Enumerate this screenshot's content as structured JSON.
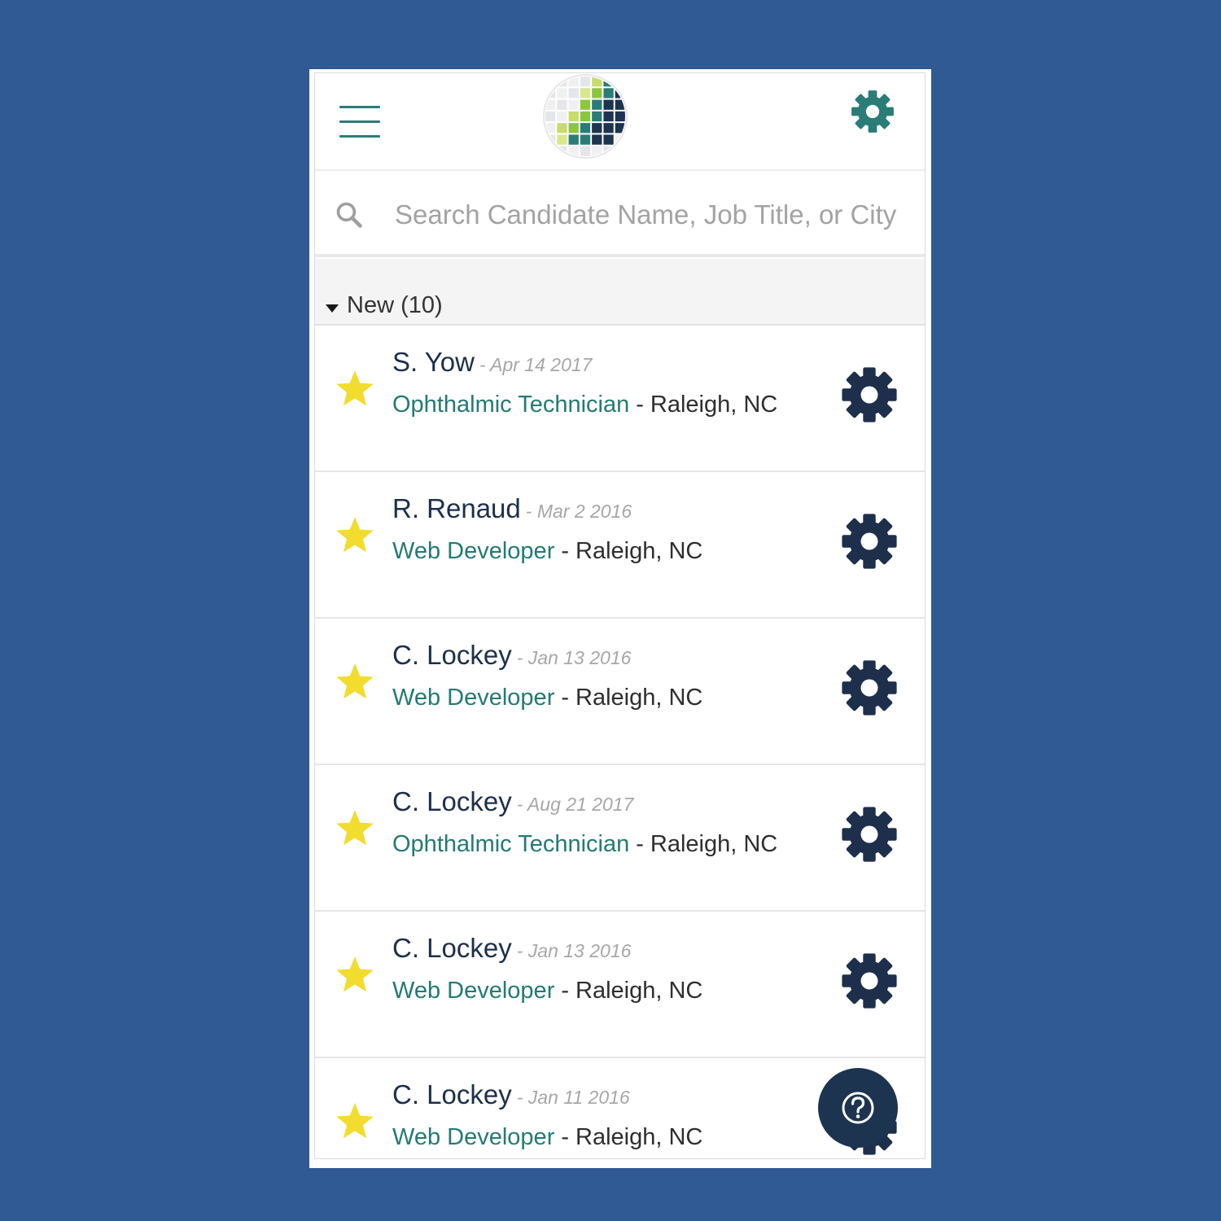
{
  "header": {
    "menu_icon": "hamburger-menu-icon",
    "logo_icon": "mosaic-grid-logo",
    "settings_icon": "gear-icon"
  },
  "search": {
    "placeholder": "Search Candidate Name, Job Title, or City",
    "icon": "search-icon"
  },
  "section": {
    "title": "New (10)",
    "icon": "caret-down-icon"
  },
  "candidates": [
    {
      "name": "S. Yow",
      "date": "- Apr 14 2017",
      "job": "Ophthalmic Technician",
      "sep": "-",
      "city": "Raleigh, NC",
      "starred": true
    },
    {
      "name": "R. Renaud",
      "date": "- Mar 2 2016",
      "job": "Web Developer",
      "sep": "-",
      "city": "Raleigh, NC",
      "starred": true
    },
    {
      "name": "C. Lockey",
      "date": "- Jan 13 2016",
      "job": "Web Developer",
      "sep": "-",
      "city": "Raleigh, NC",
      "starred": true
    },
    {
      "name": "C. Lockey",
      "date": "- Aug 21 2017",
      "job": "Ophthalmic Technician",
      "sep": "-",
      "city": "Raleigh, NC",
      "starred": true
    },
    {
      "name": "C. Lockey",
      "date": "- Jan 13 2016",
      "job": "Web Developer",
      "sep": "-",
      "city": "Raleigh, NC",
      "starred": true
    },
    {
      "name": "C. Lockey",
      "date": "- Jan 11 2016",
      "job": "Web Developer",
      "sep": "-",
      "city": "Raleigh, NC",
      "starred": true
    }
  ],
  "help": {
    "icon": "question-mark-icon"
  },
  "colors": {
    "background": "#2f5a93",
    "teal": "#237a74",
    "navy": "#1e2f4c",
    "star": "#f2dc2e",
    "muted": "#a7a7a7"
  }
}
